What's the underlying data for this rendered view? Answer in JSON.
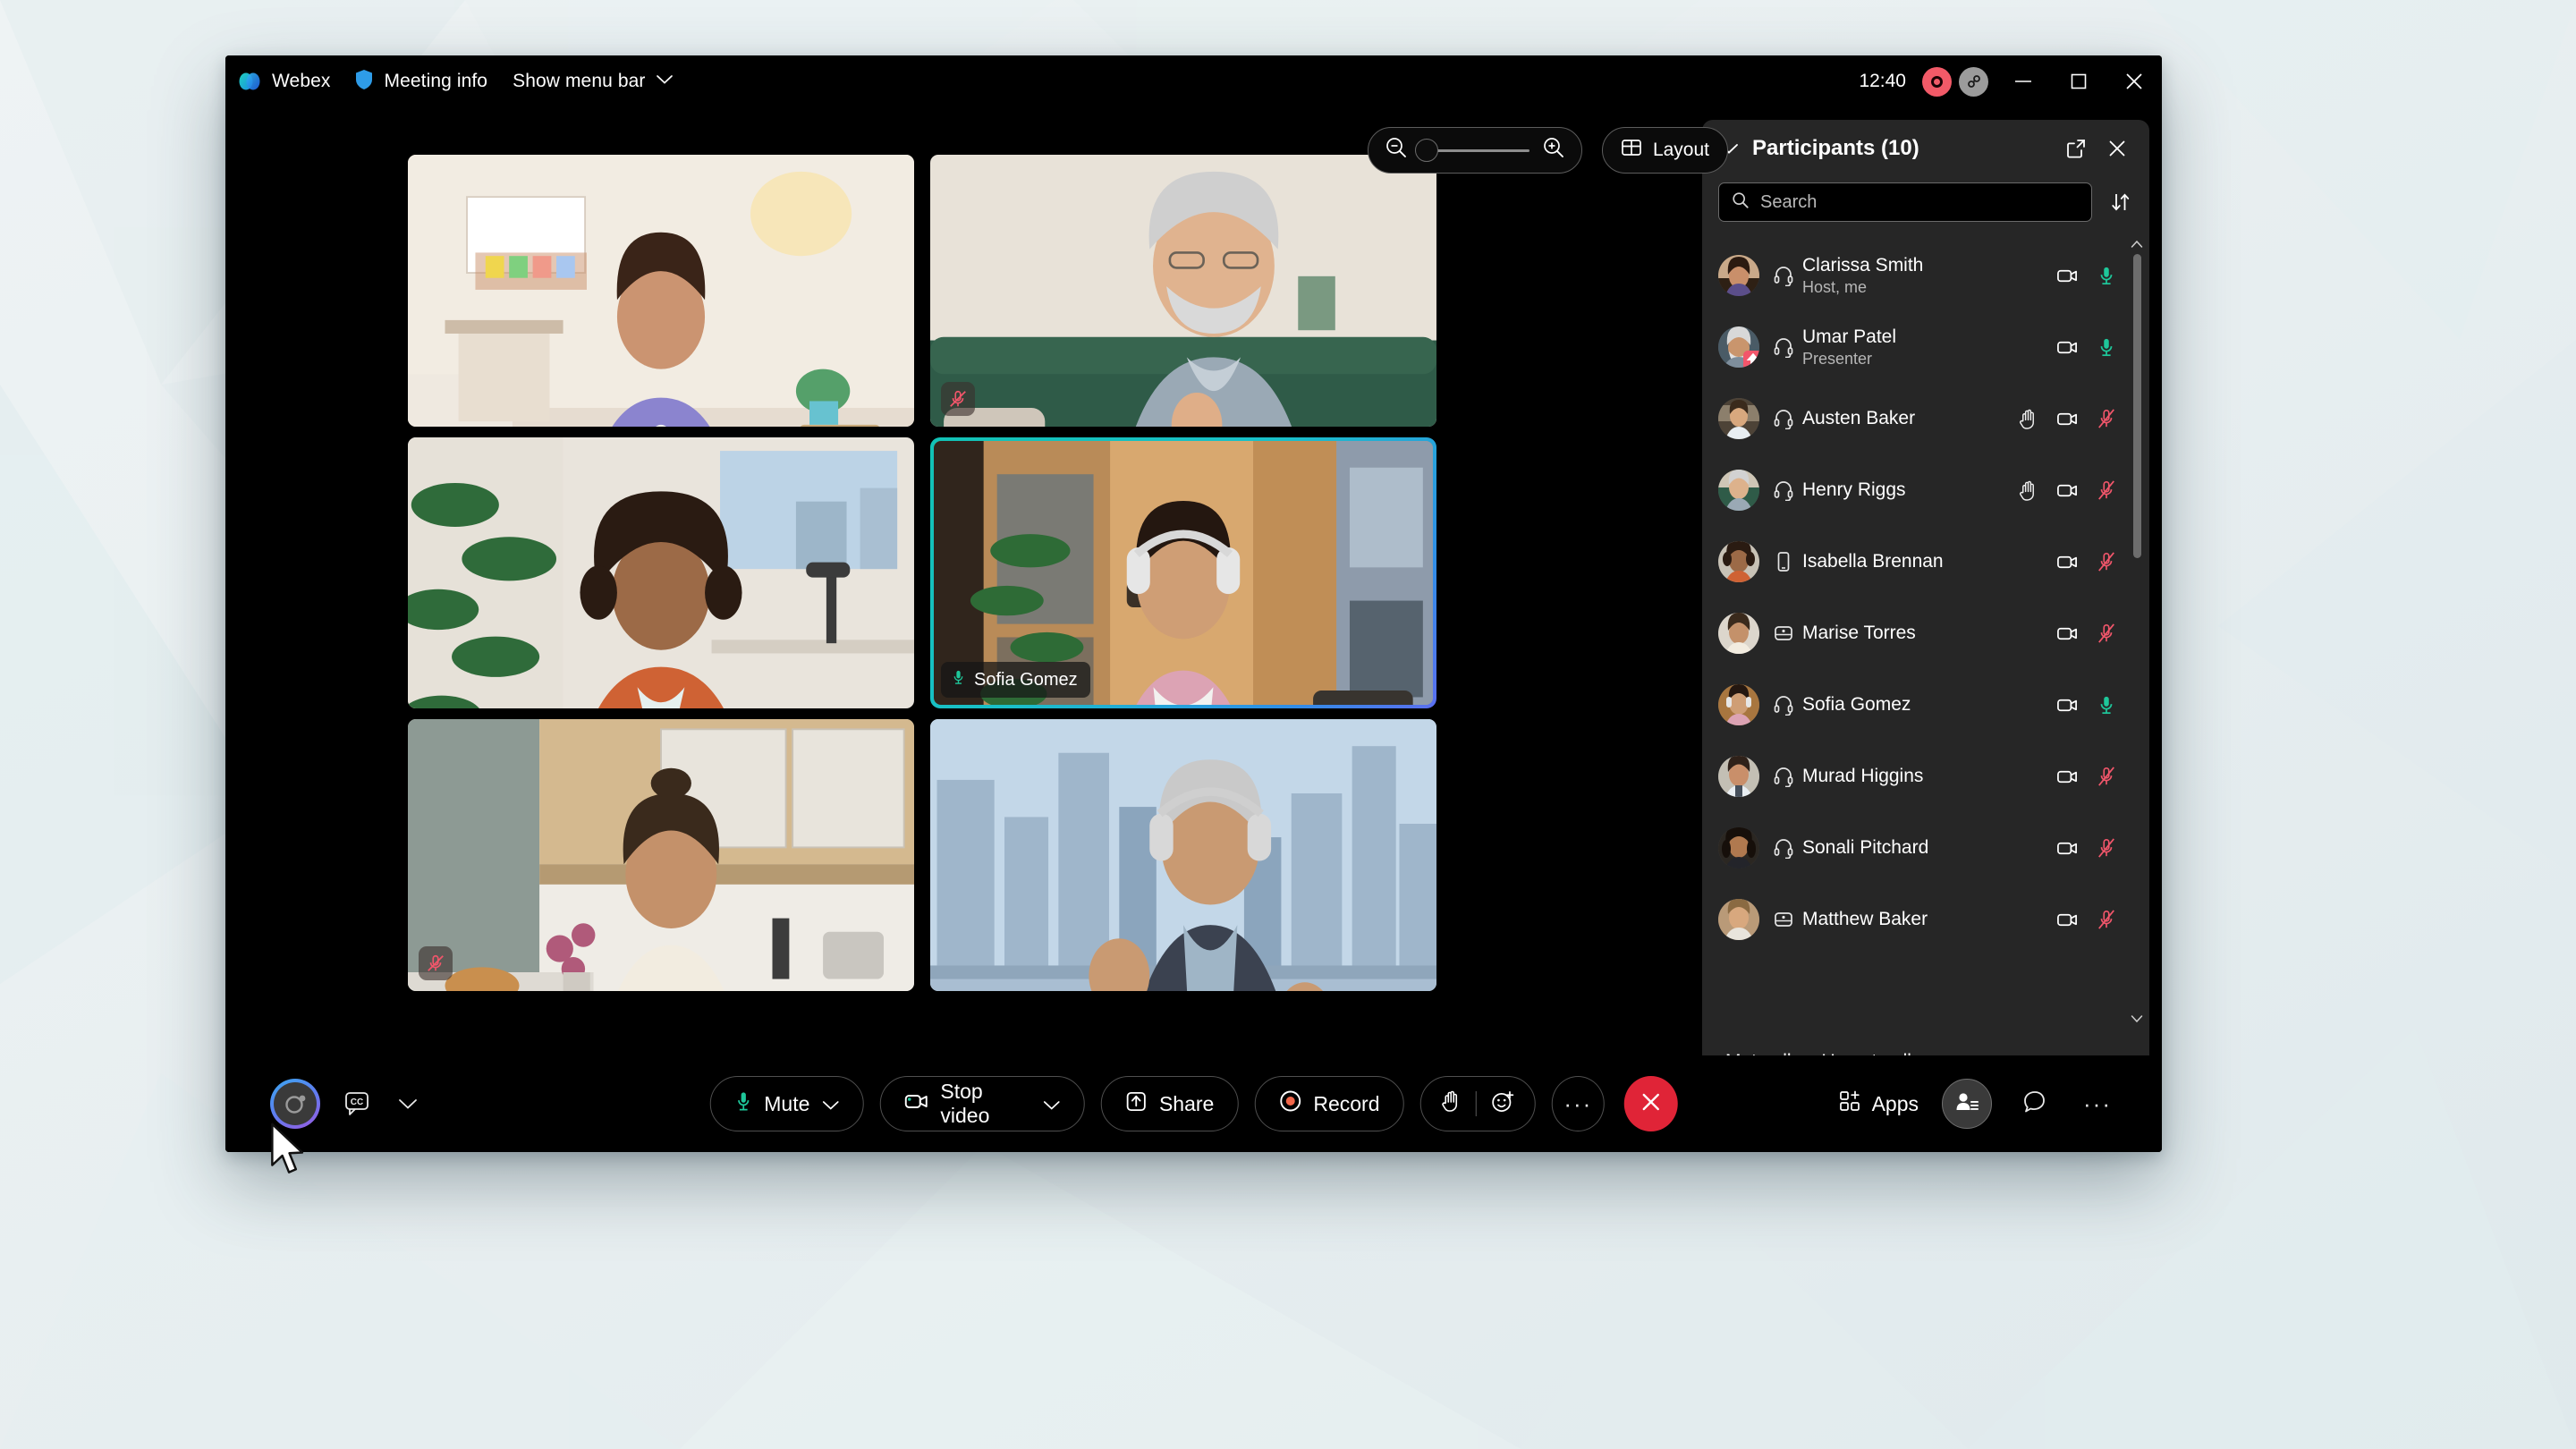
{
  "window": {
    "title_bar": {
      "app_name": "Webex",
      "meeting_info_label": "Meeting info",
      "menu_bar_label": "Show menu bar",
      "clock": "12:40",
      "icons": {
        "webex_logo": "webex-logo",
        "meeting_info": "shield-icon",
        "menu_chevron": "chevron-down-icon",
        "recording_status": "recording-indicator-icon",
        "connection_status": "link-status-icon",
        "minimize": "minimize-icon",
        "maximize": "maximize-icon",
        "close": "close-icon"
      }
    }
  },
  "stage": {
    "zoom": {
      "zoom_out_icon": "zoom-out-icon",
      "zoom_in_icon": "zoom-in-icon",
      "value": 0
    },
    "layout_button": {
      "label": "Layout",
      "icon": "grid-layout-icon"
    },
    "tiles": [
      {
        "name": "",
        "muted": false,
        "active": false,
        "badge_icon": ""
      },
      {
        "name": "",
        "muted": true,
        "active": false,
        "badge_icon": "mic-muted-icon"
      },
      {
        "name": "",
        "muted": false,
        "active": false,
        "badge_icon": ""
      },
      {
        "name": "Sofia Gomez",
        "muted": false,
        "active": true,
        "badge_icon": "mic-active-icon"
      },
      {
        "name": "",
        "muted": true,
        "active": false,
        "badge_icon": "mic-muted-icon"
      },
      {
        "name": "",
        "muted": false,
        "active": false,
        "badge_icon": ""
      }
    ]
  },
  "participants_panel": {
    "title": "Participants (10)",
    "collapse_icon": "chevron-down-icon",
    "popout_icon": "open-in-new-window-icon",
    "close_icon": "close-icon",
    "search": {
      "placeholder": "Search",
      "value": "",
      "icon": "search-icon"
    },
    "sort_icon": "sort-icon",
    "columns": [
      "avatar",
      "device",
      "name",
      "raise-hand",
      "video",
      "audio"
    ],
    "rows": [
      {
        "name": "Clarissa Smith",
        "role": "Host, me",
        "device": "headset-icon",
        "hand_raised": false,
        "video": "video-on-icon",
        "audio": "mic-unmuted-icon",
        "audio_state": "unmuted",
        "presenter": false
      },
      {
        "name": "Umar Patel",
        "role": "Presenter",
        "device": "headset-icon",
        "hand_raised": false,
        "video": "video-on-icon",
        "audio": "mic-unmuted-icon",
        "audio_state": "unmuted",
        "presenter": true
      },
      {
        "name": "Austen Baker",
        "role": "",
        "device": "headset-icon",
        "hand_raised": true,
        "video": "video-on-icon",
        "audio": "mic-muted-icon",
        "audio_state": "muted",
        "presenter": false
      },
      {
        "name": "Henry Riggs",
        "role": "",
        "device": "headset-icon",
        "hand_raised": true,
        "video": "video-on-icon",
        "audio": "mic-muted-icon",
        "audio_state": "muted",
        "presenter": false
      },
      {
        "name": "Isabella Brennan",
        "role": "",
        "device": "mobile-phone-icon",
        "hand_raised": false,
        "video": "video-on-icon",
        "audio": "mic-muted-icon",
        "audio_state": "muted",
        "presenter": false
      },
      {
        "name": "Marise Torres",
        "role": "",
        "device": "desk-device-icon",
        "hand_raised": false,
        "video": "video-on-icon",
        "audio": "mic-muted-icon",
        "audio_state": "muted",
        "presenter": false
      },
      {
        "name": "Sofia Gomez",
        "role": "",
        "device": "headset-icon",
        "hand_raised": false,
        "video": "video-on-icon",
        "audio": "mic-unmuted-icon",
        "audio_state": "unmuted",
        "presenter": false
      },
      {
        "name": "Murad Higgins",
        "role": "",
        "device": "headset-icon",
        "hand_raised": false,
        "video": "video-on-icon",
        "audio": "mic-muted-icon",
        "audio_state": "muted",
        "presenter": false
      },
      {
        "name": "Sonali Pitchard",
        "role": "",
        "device": "headset-icon",
        "hand_raised": false,
        "video": "video-on-icon",
        "audio": "mic-muted-icon",
        "audio_state": "muted",
        "presenter": false
      },
      {
        "name": "Matthew Baker",
        "role": "",
        "device": "desk-device-icon",
        "hand_raised": false,
        "video": "video-on-icon",
        "audio": "mic-muted-icon",
        "audio_state": "muted",
        "presenter": false
      }
    ],
    "footer": {
      "mute_all_label": "Mute all",
      "unmute_all_label": "Unmute all",
      "more_label": "···"
    }
  },
  "toolbar": {
    "assistant_icon": "webex-assistant-icon",
    "captions_icon": "closed-captions-icon",
    "captions_chevron_icon": "chevron-down-icon",
    "mute_label": "Mute",
    "mute_icon": "mic-unmuted-icon",
    "mute_chevron_icon": "chevron-down-icon",
    "video_label": "Stop video",
    "video_icon": "video-on-icon",
    "video_chevron_icon": "chevron-down-icon",
    "share_label": "Share",
    "share_icon": "share-screen-icon",
    "record_label": "Record",
    "record_icon": "record-icon",
    "raise_hand_icon": "raise-hand-icon",
    "reactions_icon": "reactions-icon",
    "more_label": "···",
    "leave_icon": "close-icon",
    "apps_label": "Apps",
    "apps_icon": "apps-grid-icon",
    "participants_icon": "participants-icon",
    "chat_icon": "chat-bubble-icon",
    "options_label": "···"
  },
  "colors": {
    "accent_teal": "#13c2b5",
    "accent_blue": "#2f8fe6",
    "mic_green": "#1ec79a",
    "mute_red": "#f2566b",
    "leave_red": "#e02437",
    "panel_bg": "#262626",
    "window_bg": "#000000"
  }
}
